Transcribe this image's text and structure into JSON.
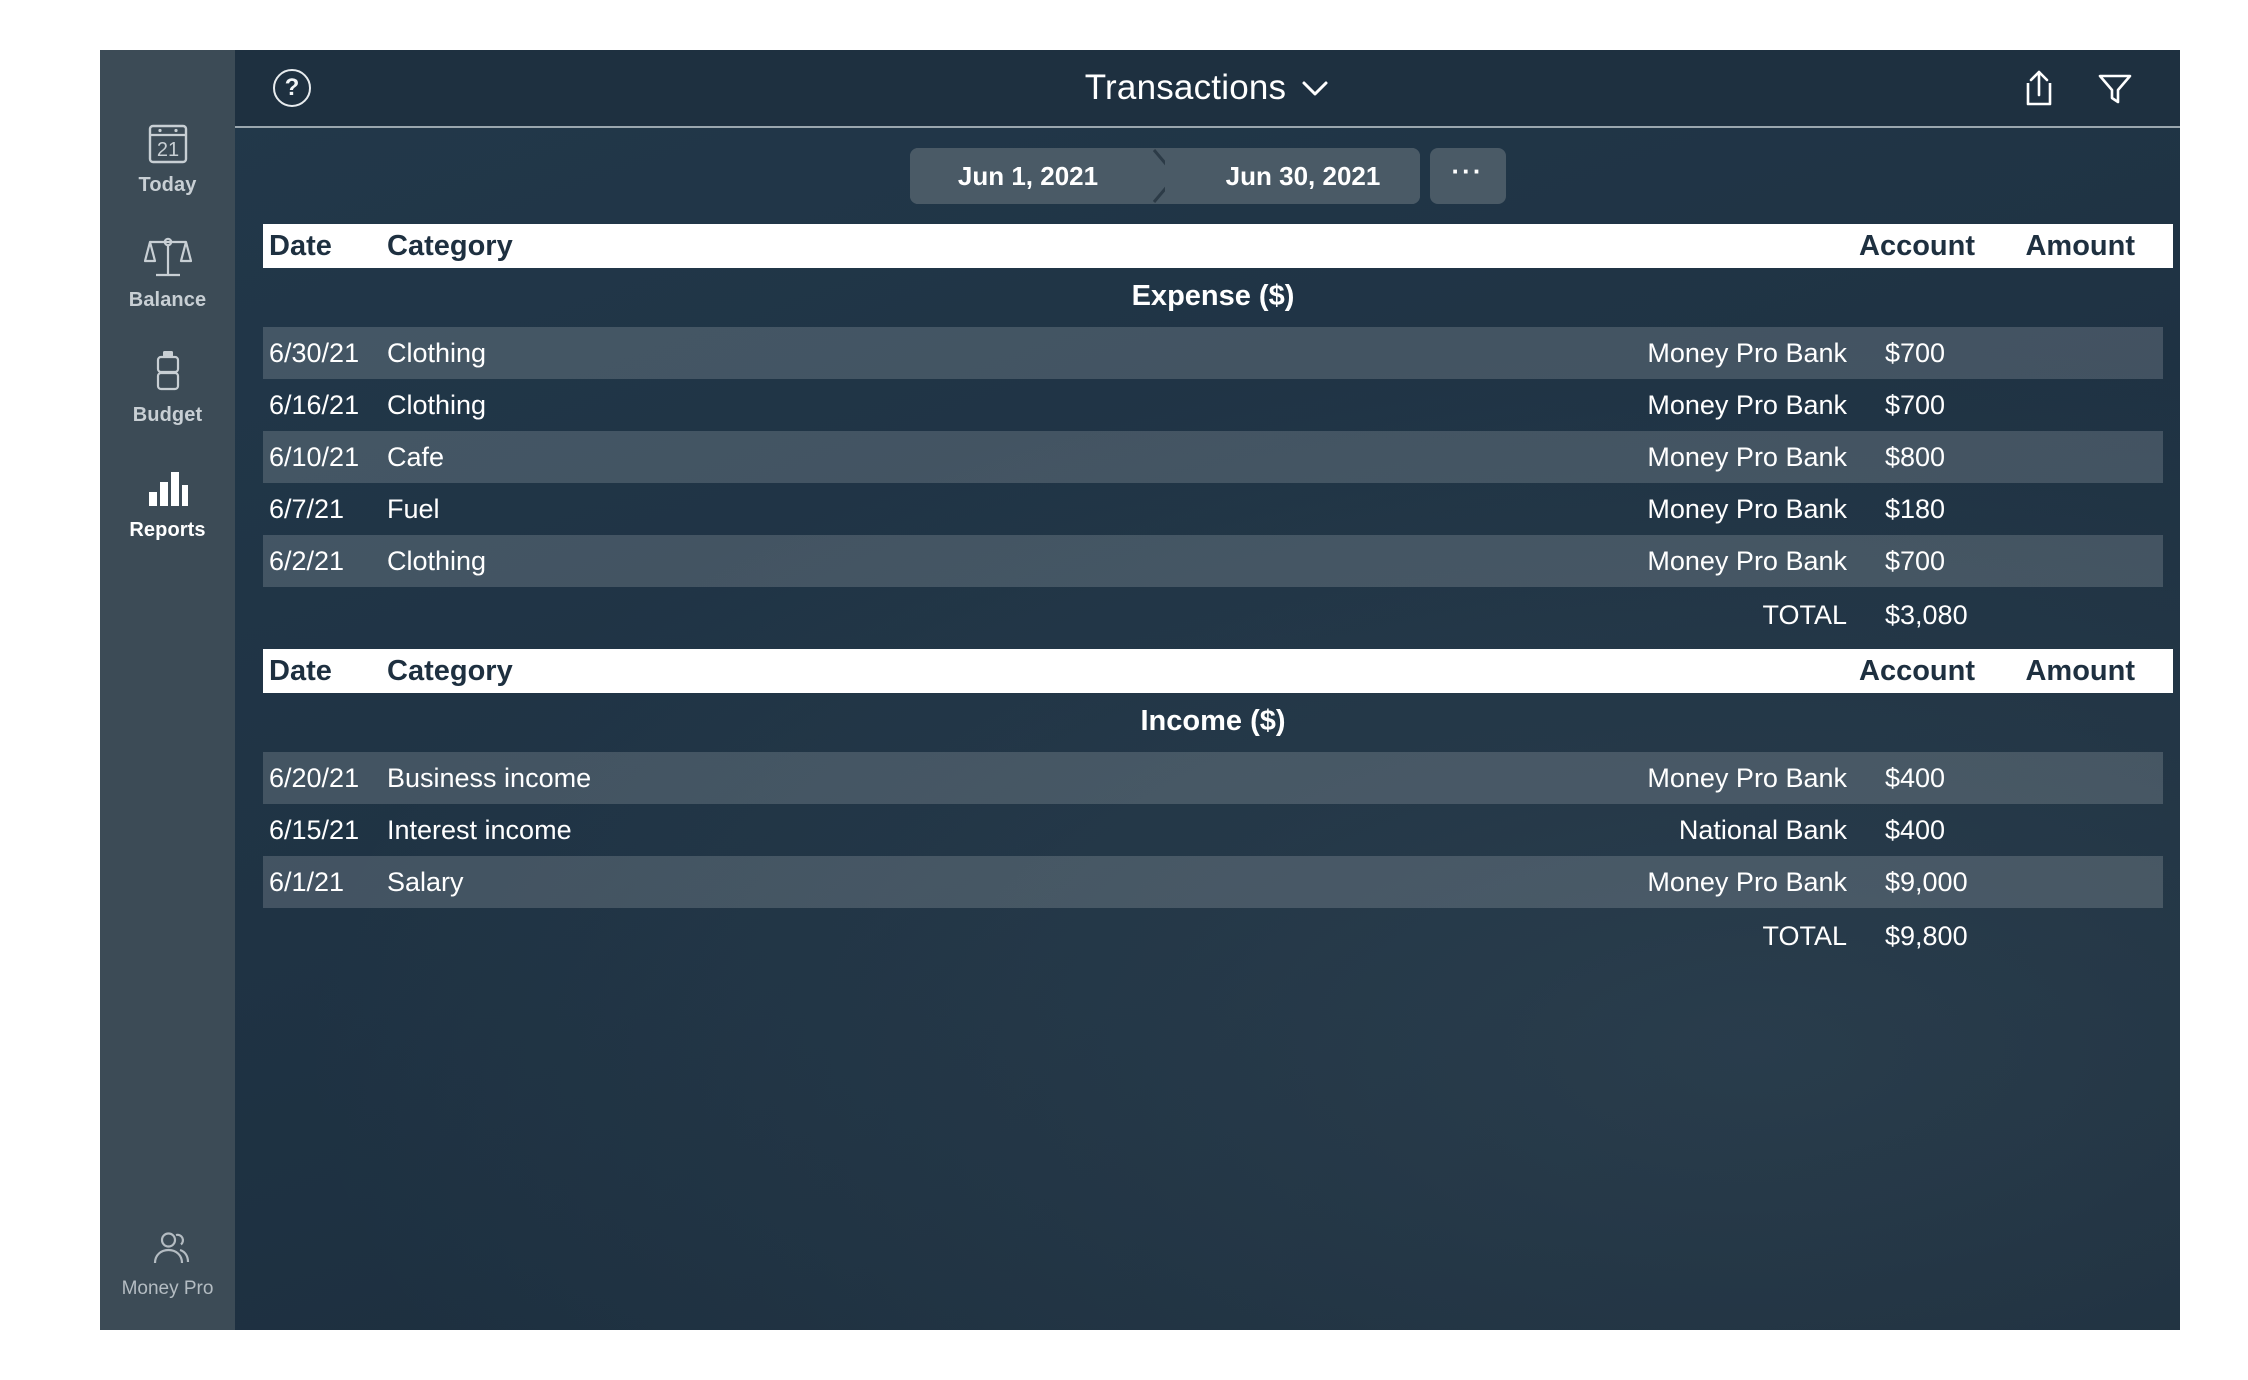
{
  "window": {
    "title": "Money Pro"
  },
  "sidebar": {
    "items": [
      {
        "label": "Today",
        "icon": "calendar-icon",
        "badge": "21",
        "active": false
      },
      {
        "label": "Balance",
        "icon": "scales-icon",
        "active": false
      },
      {
        "label": "Budget",
        "icon": "battery-icon",
        "active": false
      },
      {
        "label": "Reports",
        "icon": "bar-chart-icon",
        "active": true
      }
    ],
    "account": {
      "label": "Money Pro",
      "icon": "users-icon"
    }
  },
  "titlebar": {
    "help_label": "?",
    "title": "Transactions",
    "chevron_icon": "chevron-down-icon",
    "share_icon": "share-icon",
    "filter_icon": "filter-icon"
  },
  "daterange": {
    "start": "Jun 1, 2021",
    "end": "Jun 30, 2021",
    "more_label": "···"
  },
  "columns": {
    "date": "Date",
    "category": "Category",
    "account": "Account",
    "amount": "Amount"
  },
  "total_label": "TOTAL",
  "sections": [
    {
      "title": "Expense ($)",
      "rows": [
        {
          "date": "6/30/21",
          "category": "Clothing",
          "account": "Money Pro Bank",
          "amount": "$700"
        },
        {
          "date": "6/16/21",
          "category": "Clothing",
          "account": "Money Pro Bank",
          "amount": "$700"
        },
        {
          "date": "6/10/21",
          "category": "Cafe",
          "account": "Money Pro Bank",
          "amount": "$800"
        },
        {
          "date": "6/7/21",
          "category": "Fuel",
          "account": "Money Pro Bank",
          "amount": "$180"
        },
        {
          "date": "6/2/21",
          "category": "Clothing",
          "account": "Money Pro Bank",
          "amount": "$700"
        }
      ],
      "total": "$3,080"
    },
    {
      "title": "Income ($)",
      "rows": [
        {
          "date": "6/20/21",
          "category": "Business income",
          "account": "Money Pro Bank",
          "amount": "$400"
        },
        {
          "date": "6/15/21",
          "category": "Interest income",
          "account": "National Bank",
          "amount": "$400"
        },
        {
          "date": "6/1/21",
          "category": "Salary",
          "account": "Money Pro Bank",
          "amount": "$9,000"
        }
      ],
      "total": "$9,800"
    }
  ],
  "colors": {
    "sidebar_bg": "#3c4b56",
    "window_bg": "#1e3040",
    "header_strip": "#ffffff",
    "row_highlight": "rgba(255,255,255,0.16)",
    "text": "#ffffff"
  }
}
